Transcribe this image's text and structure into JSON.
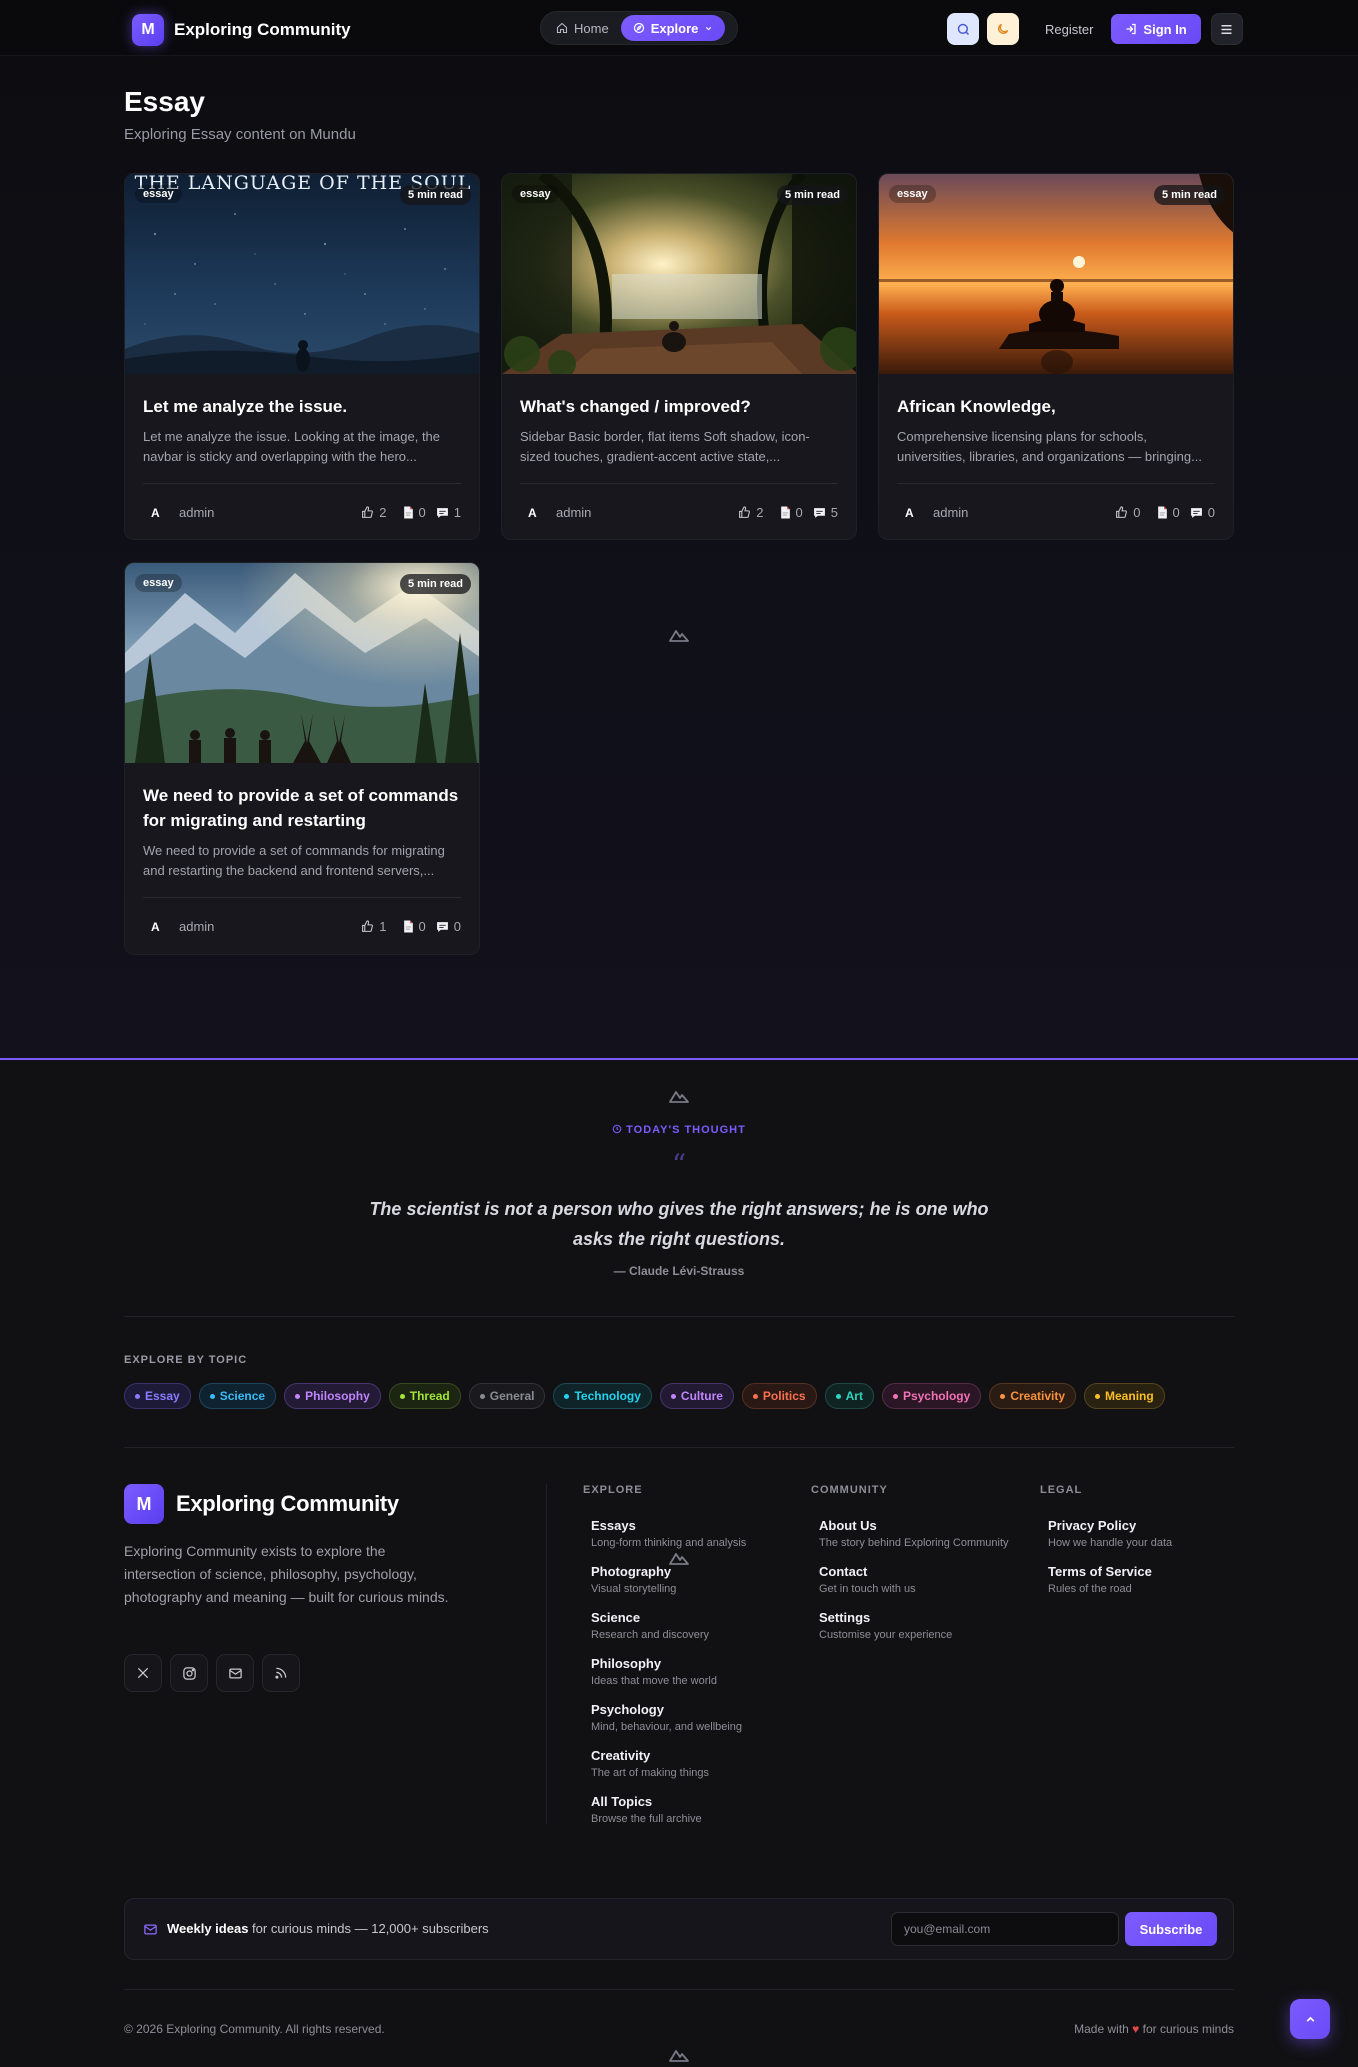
{
  "nav": {
    "brand_initial": "M",
    "brand_name": "Exploring Community",
    "home_label": "Home",
    "explore_label": "Explore",
    "register_label": "Register",
    "signin_label": "Sign In"
  },
  "header": {
    "title": "Essay",
    "subtitle": "Exploring Essay content on Mundu"
  },
  "cards": [
    {
      "tag": "essay",
      "read_time": "5 min read",
      "image_text": "THE LANGUAGE OF THE SOUL",
      "title": "Let me analyze the issue.",
      "excerpt": "Let me analyze the issue. Looking at the image, the navbar is sticky and overlapping with the hero...",
      "author_initial": "A",
      "author": "admin",
      "likes": "2",
      "docs": "0",
      "comments": "1"
    },
    {
      "tag": "essay",
      "read_time": "5 min read",
      "title": "What's changed / improved?",
      "excerpt": "Sidebar Basic border, flat items Soft shadow, icon-sized touches, gradient-accent active state,...",
      "author_initial": "A",
      "author": "admin",
      "likes": "2",
      "docs": "0",
      "comments": "5"
    },
    {
      "tag": "essay",
      "read_time": "5 min read",
      "title": "African Knowledge,",
      "excerpt": "Comprehensive licensing plans for schools, universities, libraries, and organizations — bringing...",
      "author_initial": "A",
      "author": "admin",
      "likes": "0",
      "docs": "0",
      "comments": "0"
    },
    {
      "tag": "essay",
      "read_time": "5 min read",
      "title": "We need to provide a set of commands for migrating and restarting",
      "excerpt": "We need to provide a set of commands for migrating and restarting the backend and frontend servers,...",
      "author_initial": "A",
      "author": "admin",
      "likes": "1",
      "docs": "0",
      "comments": "0"
    }
  ],
  "thought": {
    "label": "TODAY'S THOUGHT",
    "quote_mark": "“",
    "text": "The scientist is not a person who gives the right answers; he is one who asks the right questions.",
    "author": "— Claude Lévi-Strauss"
  },
  "topics": {
    "label": "EXPLORE BY TOPIC",
    "items": [
      {
        "name": "Essay",
        "color": "#8b7cff",
        "bg": "#1d1a38",
        "border": "#3a3370"
      },
      {
        "name": "Science",
        "color": "#38bdf8",
        "bg": "#0f2230",
        "border": "#1d4660"
      },
      {
        "name": "Philosophy",
        "color": "#c084fc",
        "bg": "#231a36",
        "border": "#4a3470"
      },
      {
        "name": "Thread",
        "color": "#a3e635",
        "bg": "#1c2412",
        "border": "#3a4a20"
      },
      {
        "name": "General",
        "color": "#8a8a94",
        "bg": "#1a1a1e",
        "border": "#333338"
      },
      {
        "name": "Technology",
        "color": "#22d3ee",
        "bg": "#0e2429",
        "border": "#1d4a54"
      },
      {
        "name": "Culture",
        "color": "#c084fc",
        "bg": "#221a32",
        "border": "#46346a"
      },
      {
        "name": "Politics",
        "color": "#fb7150",
        "bg": "#2a1814",
        "border": "#553024"
      },
      {
        "name": "Art",
        "color": "#2dd4bf",
        "bg": "#0f2422",
        "border": "#1f4a44"
      },
      {
        "name": "Psychology",
        "color": "#f472b6",
        "bg": "#2a1624",
        "border": "#552c48"
      },
      {
        "name": "Creativity",
        "color": "#fb923c",
        "bg": "#2a1c12",
        "border": "#553820"
      },
      {
        "name": "Meaning",
        "color": "#fbbf24",
        "bg": "#2a2210",
        "border": "#554420"
      }
    ]
  },
  "footer": {
    "brand_initial": "M",
    "brand_name": "Exploring Community",
    "description": "Exploring Community exists to explore the intersection of science, philosophy, psychology, photography and meaning — built for curious minds.",
    "columns": [
      {
        "heading": "EXPLORE",
        "links": [
          {
            "title": "Essays",
            "sub": "Long-form thinking and analysis"
          },
          {
            "title": "Photography",
            "sub": "Visual storytelling"
          },
          {
            "title": "Science",
            "sub": "Research and discovery"
          },
          {
            "title": "Philosophy",
            "sub": "Ideas that move the world"
          },
          {
            "title": "Psychology",
            "sub": "Mind, behaviour, and wellbeing"
          },
          {
            "title": "Creativity",
            "sub": "The art of making things"
          },
          {
            "title": "All Topics",
            "sub": "Browse the full archive"
          }
        ]
      },
      {
        "heading": "COMMUNITY",
        "links": [
          {
            "title": "About Us",
            "sub": "The story behind Exploring Community"
          },
          {
            "title": "Contact",
            "sub": "Get in touch with us"
          },
          {
            "title": "Settings",
            "sub": "Customise your experience"
          }
        ]
      },
      {
        "heading": "LEGAL",
        "links": [
          {
            "title": "Privacy Policy",
            "sub": "How we handle your data"
          },
          {
            "title": "Terms of Service",
            "sub": "Rules of the road"
          }
        ]
      }
    ],
    "newsletter": {
      "bold": "Weekly ideas",
      "text": " for curious minds — 12,000+ subscribers",
      "placeholder": "you@email.com",
      "button": "Subscribe"
    },
    "copyright": "© 2026 Exploring Community. All rights reserved.",
    "made_with_prefix": "Made with ",
    "heart": "♥",
    "made_with_suffix": " for curious minds"
  }
}
